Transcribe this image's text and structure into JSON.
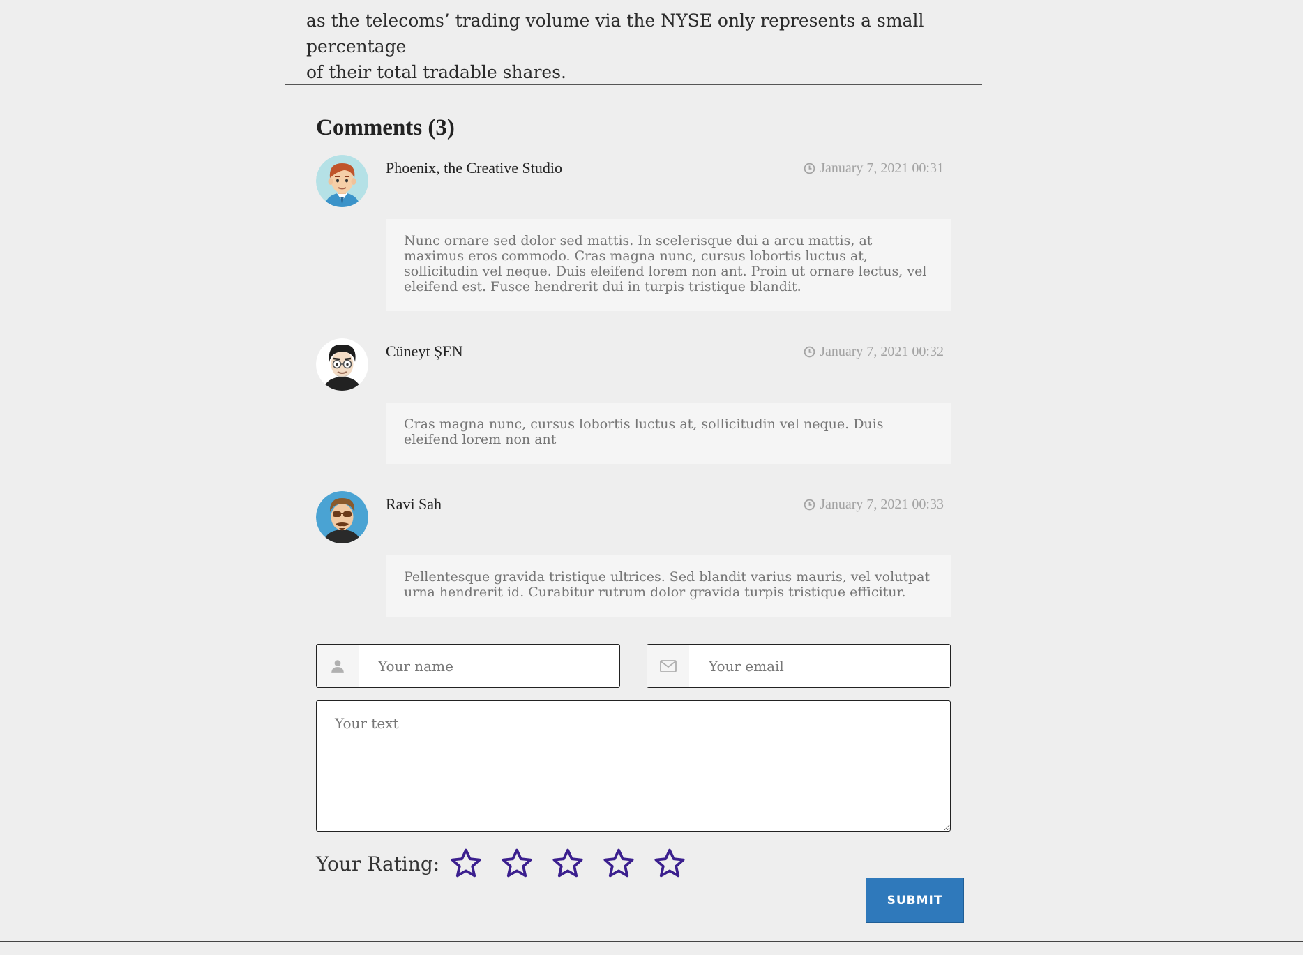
{
  "article": {
    "line1": "as the telecoms’ trading volume via the NYSE only represents a small percentage",
    "line2": "of their total tradable shares."
  },
  "comments_section": {
    "title": "Comments (3)",
    "items": [
      {
        "author": "Phoenix, the Creative Studio",
        "date": "January 7, 2021 00:31",
        "text": "Nunc ornare sed dolor sed mattis. In scelerisque dui a arcu mattis, at maximus eros commodo. Cras magna nunc, cursus lobortis luctus at, sollicitudin vel neque. Duis eleifend lorem non ant. Proin ut ornare lectus, vel eleifend est. Fusce hendrerit dui in turpis tristique blandit.",
        "avatar": "avatar-red-hair-man-icon"
      },
      {
        "author": "Cüneyt ŞEN",
        "date": "January 7, 2021 00:32",
        "text": "Cras magna nunc, cursus lobortis luctus at, sollicitudin vel neque. Duis eleifend lorem non ant",
        "avatar": "avatar-glasses-man-icon"
      },
      {
        "author": "Ravi Sah",
        "date": "January 7, 2021 00:33",
        "text": "Pellentesque gravida tristique ultrices. Sed blandit varius mauris, vel volutpat urna hendrerit id. Curabitur rutrum dolor gravida turpis tristique efficitur.",
        "avatar": "avatar-sunglasses-man-icon"
      }
    ]
  },
  "form": {
    "name_placeholder": "Your name",
    "email_placeholder": "Your email",
    "text_placeholder": "Your text",
    "rating_label": "Your Rating:",
    "rating_value": 0,
    "rating_max": 5,
    "submit_label": "SUBMIT"
  },
  "colors": {
    "star": "#3b1f8e",
    "submit": "#2f79bb"
  }
}
